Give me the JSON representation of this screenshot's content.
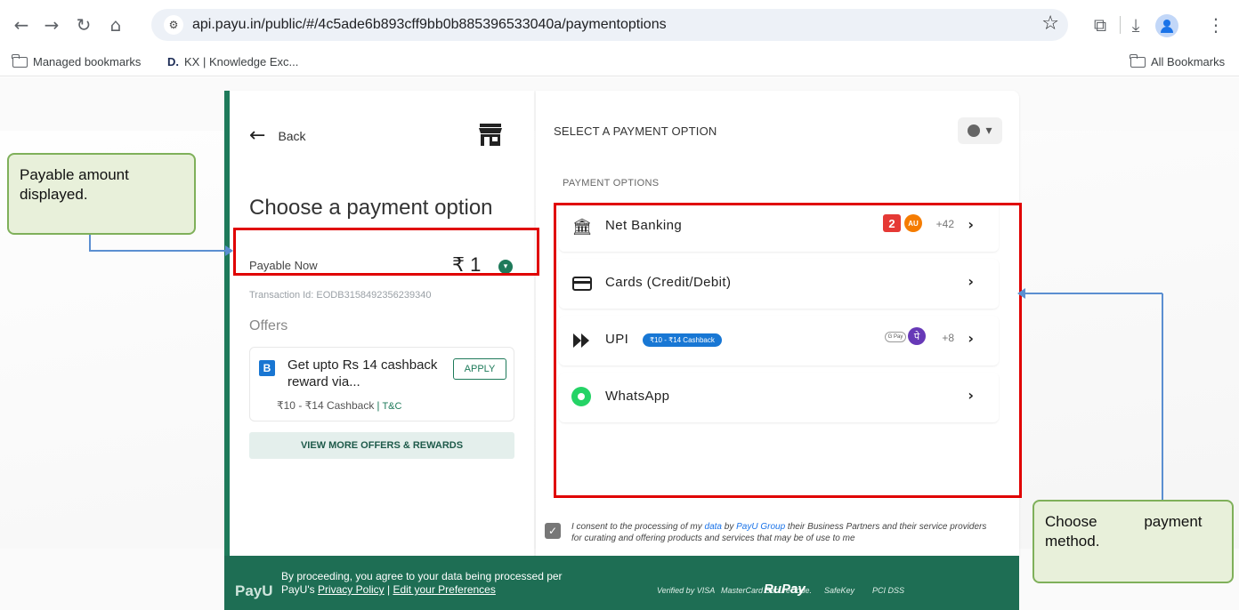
{
  "browser": {
    "url": "api.payu.in/public/#/4c5ade6b893cff9bb0b885396533040a/paymentoptions",
    "bookmarks": {
      "managed": "Managed bookmarks",
      "kx_icon": "D.",
      "kx": "KX | Knowledge Exc...",
      "all": "All Bookmarks"
    }
  },
  "left_panel": {
    "back": "Back",
    "title": "Choose a payment option",
    "payable_label": "Payable Now",
    "payable_amount": "₹ 1",
    "transaction": "Transaction Id: EODB3158492356239340",
    "offers_heading": "Offers",
    "offer": {
      "logo": "B",
      "title": "Get upto Rs 14 cashback reward via...",
      "apply": "APPLY",
      "cashback": "₹10 - ₹14 Cashback",
      "tc": "T&C"
    },
    "more_offers": "VIEW MORE OFFERS & REWARDS"
  },
  "right_panel": {
    "title": "SELECT A PAYMENT OPTION",
    "section_label": "PAYMENT OPTIONS",
    "options": [
      {
        "label": "Net Banking",
        "extra": "+42",
        "bank1": "2",
        "bank2": "AU"
      },
      {
        "label": "Cards (Credit/Debit)"
      },
      {
        "label": "UPI",
        "badge": "₹10 - ₹14 Cashback",
        "gpay": "G Pay",
        "extra": "+8"
      },
      {
        "label": "WhatsApp"
      }
    ],
    "consent": {
      "part1": "I consent to the processing of my ",
      "data_link": "data",
      "part2": " by ",
      "group_link": "PayU Group",
      "part3": " their Business Partners and their service providers for curating and offering products and services that may be of use to me"
    }
  },
  "footer": {
    "logo": "PayU",
    "line1": "By proceeding, you agree to your data being processed per",
    "line2_pre": "PayU's ",
    "privacy": "Privacy Policy",
    "line2_sep": " | ",
    "prefs": "Edit your Preferences",
    "certs": [
      "Verified by VISA",
      "MasterCard SecureCode.",
      "RuPay",
      "SafeKey",
      "PCI DSS"
    ]
  },
  "annotations": {
    "left_note": "Payable amount displayed.",
    "right_note": "Choose payment method."
  },
  "colors": {
    "brand_green": "#1e7a5a",
    "annotation_red": "#e00000",
    "annotation_note_bg": "#e8f0da",
    "connector_blue": "#5b8fd1"
  }
}
